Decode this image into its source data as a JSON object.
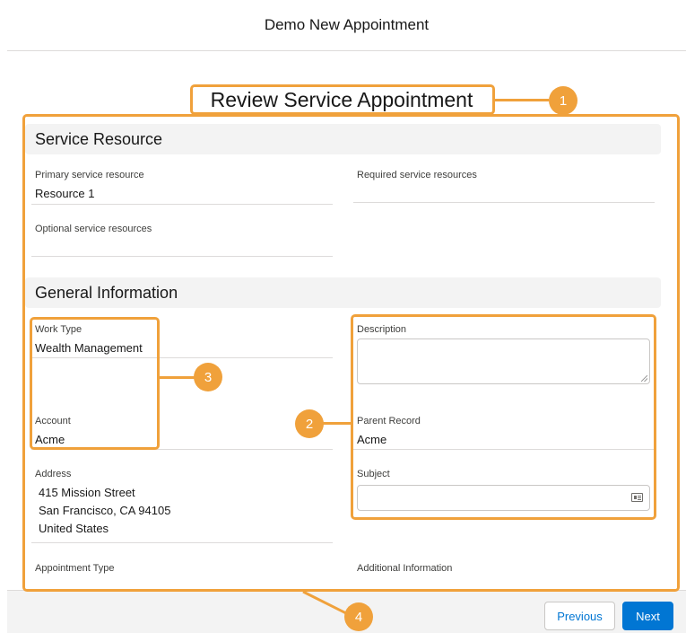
{
  "header": {
    "title": "Demo New Appointment"
  },
  "page_title": "Review Service Appointment",
  "service_resource": {
    "section_title": "Service Resource",
    "primary_label": "Primary service resource",
    "primary_value": "Resource 1",
    "required_label": "Required service resources",
    "required_value": "",
    "optional_label": "Optional service resources",
    "optional_value": ""
  },
  "general_information": {
    "section_title": "General Information",
    "work_type_label": "Work Type",
    "work_type_value": "Wealth Management",
    "account_label": "Account",
    "account_value": "Acme",
    "address_label": "Address",
    "address_lines": [
      "415 Mission Street",
      "San Francisco, CA 94105",
      "United States"
    ],
    "appointment_type_label": "Appointment Type",
    "description_label": "Description",
    "description_value": "",
    "parent_record_label": "Parent Record",
    "parent_record_value": "Acme",
    "subject_label": "Subject",
    "subject_value": "",
    "subject_icon": "record-lookup-icon",
    "additional_info_label": "Additional Information"
  },
  "footer": {
    "previous_label": "Previous",
    "next_label": "Next"
  },
  "callouts": {
    "one": "1",
    "two": "2",
    "three": "3",
    "four": "4"
  },
  "colors": {
    "callout": "#f0a13b",
    "brand": "#0176d3",
    "section_bg": "#f3f3f3"
  }
}
